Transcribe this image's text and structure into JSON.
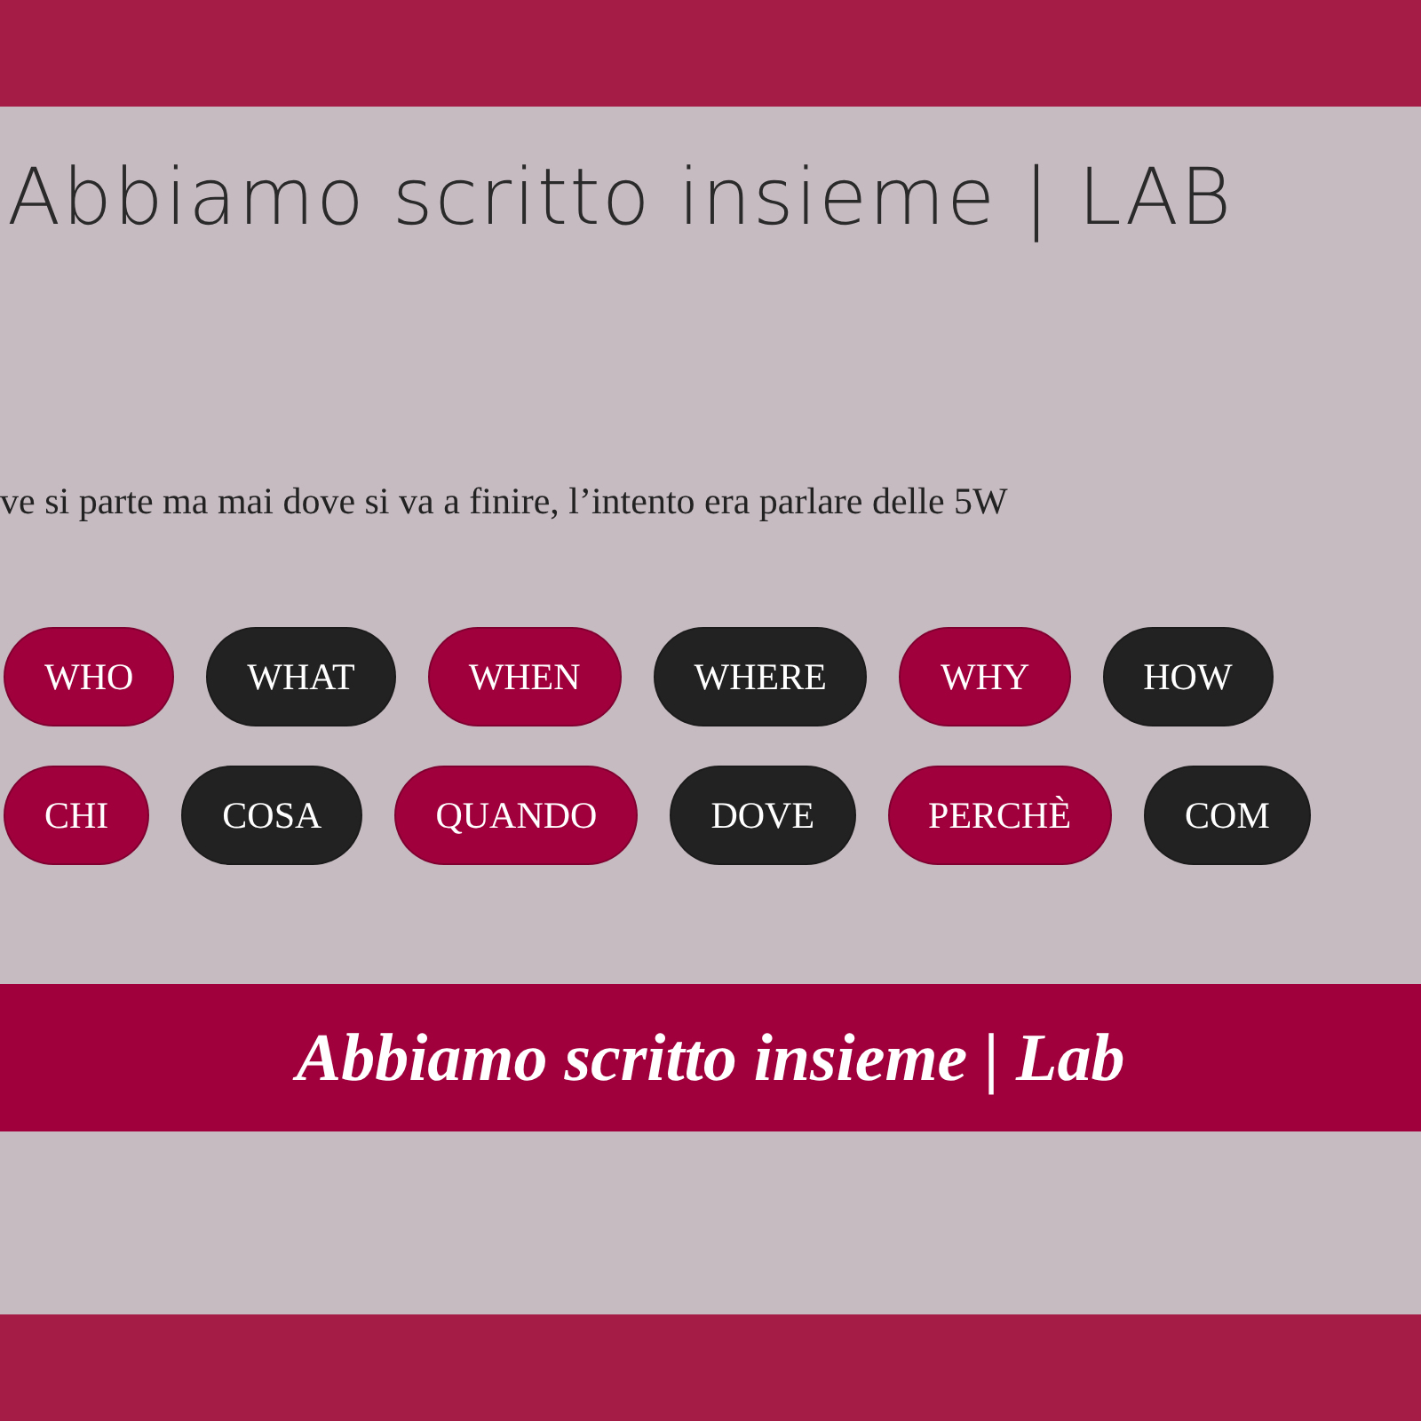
{
  "title": "Abbiamo scritto insieme | LAB",
  "intro": "ve si parte ma mai dove si va a finire, l’intento era parlare delle 5W",
  "tag_rows": [
    [
      {
        "label": "WHO",
        "color": "#a0003c"
      },
      {
        "label": "WHAT",
        "color": "#222222"
      },
      {
        "label": "WHEN",
        "color": "#a0003c"
      },
      {
        "label": "WHERE",
        "color": "#222222"
      },
      {
        "label": "WHY",
        "color": "#a0003c"
      },
      {
        "label": "HOW",
        "color": "#222222"
      }
    ],
    [
      {
        "label": "CHI",
        "color": "#a0003c"
      },
      {
        "label": "COSA",
        "color": "#222222"
      },
      {
        "label": "QUANDO",
        "color": "#a0003c"
      },
      {
        "label": "DOVE",
        "color": "#222222"
      },
      {
        "label": "PERCHÈ",
        "color": "#a0003c"
      },
      {
        "label": "COM",
        "color": "#222222"
      }
    ]
  ],
  "banner": "Abbiamo scritto insieme | Lab"
}
